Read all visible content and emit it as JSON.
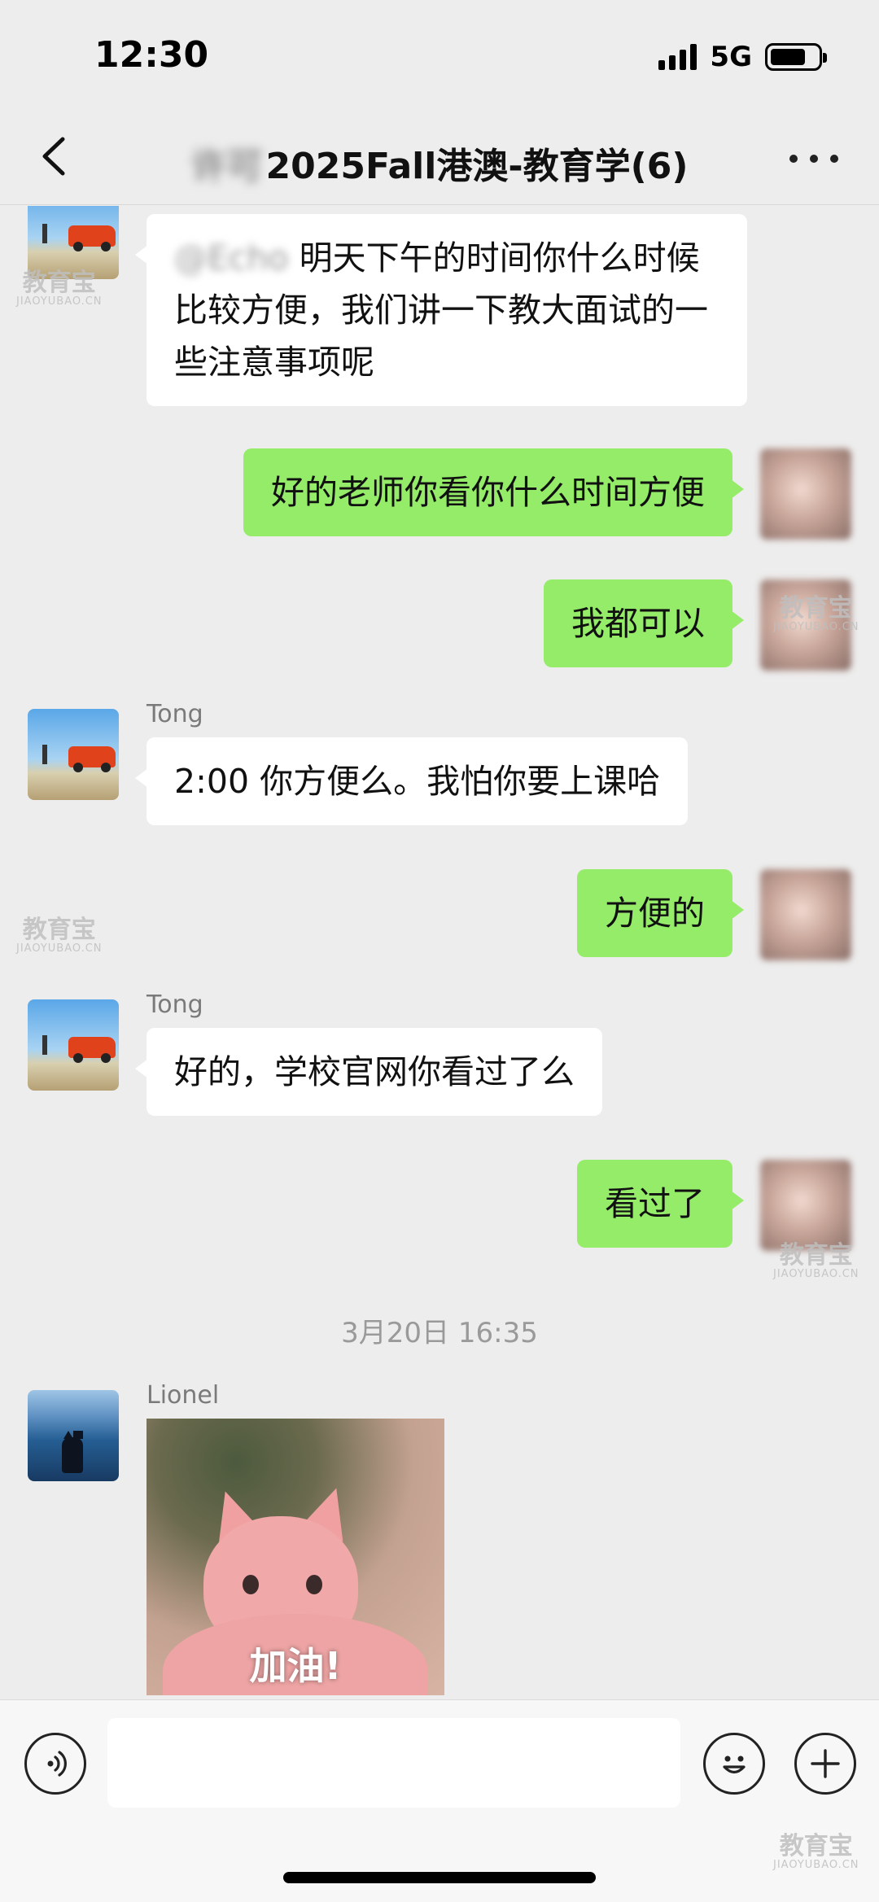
{
  "status_bar": {
    "time": "12:30",
    "network": "5G"
  },
  "header": {
    "title_prefix": "许可",
    "title": "2025Fall港澳-教育学(6)"
  },
  "messages": [
    {
      "side": "in",
      "sender": "",
      "mention": "@Echo",
      "text": "明天下午的时间你什么时候比较方便，我们讲一下教大面试的一些注意事项呢"
    },
    {
      "side": "out",
      "text": "好的老师你看你什么时间方便"
    },
    {
      "side": "out",
      "text": "我都可以"
    },
    {
      "side": "in",
      "sender": "Tong",
      "text": "2:00 你方便么。我怕你要上课哈"
    },
    {
      "side": "out",
      "text": "方便的"
    },
    {
      "side": "in",
      "sender": "Tong",
      "text": "好的，学校官网你看过了么"
    },
    {
      "side": "out",
      "text": "看过了"
    }
  ],
  "timestamp": "3月20日 16:35",
  "sticker_message": {
    "sender": "Lionel",
    "caption": "加油!"
  },
  "watermark": {
    "brand": "教育宝",
    "url": "JIAOYUBAO.CN"
  },
  "colors": {
    "background": "#ededed",
    "outgoing_bubble": "#95ec69",
    "incoming_bubble": "#ffffff"
  },
  "input_bar": {
    "placeholder": ""
  }
}
